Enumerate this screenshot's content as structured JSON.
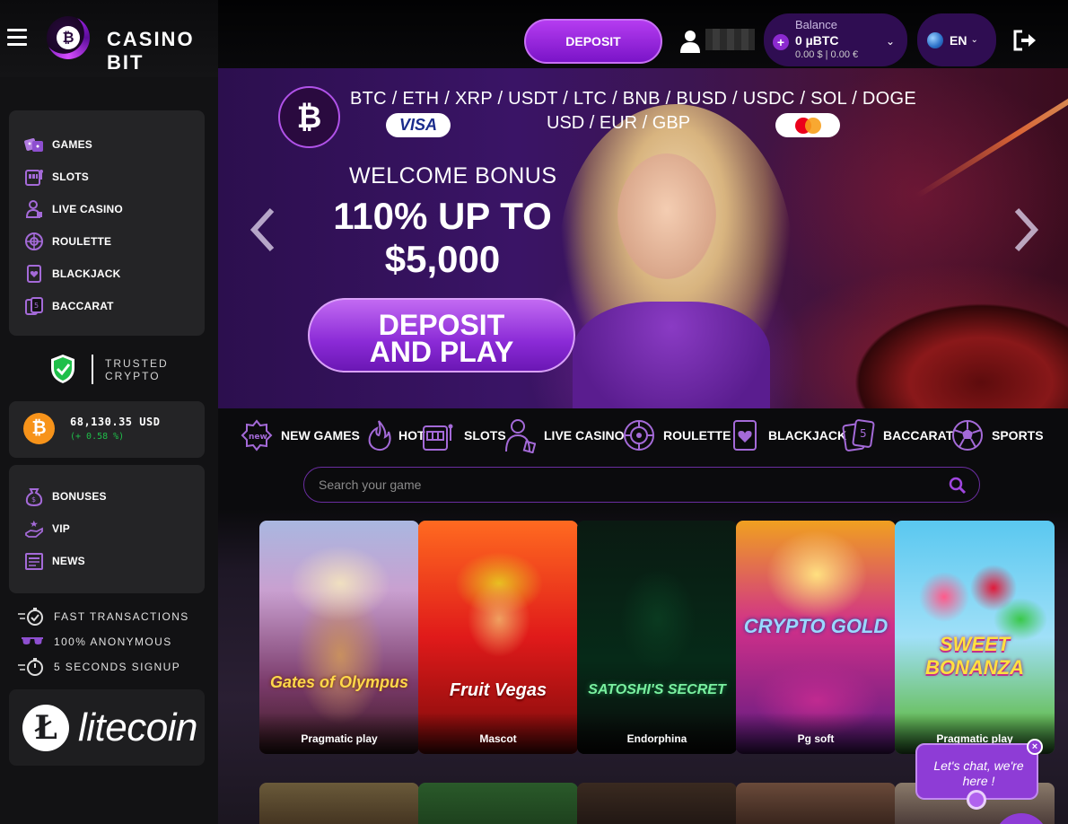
{
  "header": {
    "brand": "CASINO BIT",
    "deposit_label": "DEPOSIT",
    "balance_label": "Balance",
    "balance_value": "0 µBTC",
    "balance_sub": "0.00 $  |   0.00 €",
    "language": "EN"
  },
  "sidebar": {
    "nav": [
      {
        "label": "GAMES",
        "icon": "dice-icon"
      },
      {
        "label": "SLOTS",
        "icon": "slot-machine-icon"
      },
      {
        "label": "LIVE CASINO",
        "icon": "dealer-icon"
      },
      {
        "label": "ROULETTE",
        "icon": "roulette-icon"
      },
      {
        "label": "BLACKJACK",
        "icon": "card-heart-icon"
      },
      {
        "label": "BACCARAT",
        "icon": "cards-icon"
      }
    ],
    "trusted_line1": "TRUSTED",
    "trusted_line2": "CRYPTO",
    "btc_price": "68,130.35 USD",
    "btc_change": "(+ 0.58 %)",
    "info_nav": [
      {
        "label": "BONUSES",
        "icon": "money-bag-icon"
      },
      {
        "label": "VIP",
        "icon": "vip-hand-icon"
      },
      {
        "label": "NEWS",
        "icon": "newspaper-icon"
      }
    ],
    "features": [
      {
        "label": "FAST TRANSACTIONS",
        "icon": "stopwatch-check-icon"
      },
      {
        "label": "100% ANONYMOUS",
        "icon": "sunglasses-icon"
      },
      {
        "label": "5 SECONDS SIGNUP",
        "icon": "stopwatch-icon"
      }
    ],
    "litecoin_text": "litecoin"
  },
  "hero": {
    "cryptos": "BTC / ETH / XRP / USDT / LTC / BNB / BUSD / USDC / SOL / DOGE",
    "fiat": "USD / EUR / GBP",
    "visa": "VISA",
    "welcome": "WELCOME BONUS",
    "amount_line1": "110% UP TO",
    "amount_line2": "$5,000",
    "cta_line1": "DEPOSIT",
    "cta_line2": "AND PLAY"
  },
  "categories": [
    {
      "label": "NEW GAMES",
      "icon": "new-badge-icon"
    },
    {
      "label": "HOT",
      "icon": "flame-icon"
    },
    {
      "label": "SLOTS",
      "icon": "slot-machine-icon"
    },
    {
      "label": "LIVE CASINO",
      "icon": "dealer-icon"
    },
    {
      "label": "ROULETTE",
      "icon": "roulette-icon"
    },
    {
      "label": "BLACKJACK",
      "icon": "card-heart-icon"
    },
    {
      "label": "BACCARAT",
      "icon": "cards-icon"
    },
    {
      "label": "SPORTS",
      "icon": "soccer-ball-icon"
    }
  ],
  "search": {
    "placeholder": "Search your game"
  },
  "games": [
    {
      "title": "Gates of Olympus",
      "provider": "Pragmatic play"
    },
    {
      "title": "Fruit Vegas",
      "provider": "Mascot"
    },
    {
      "title": "SATOSHI'S SECRET",
      "provider": "Endorphina"
    },
    {
      "title": "CRYPTO GOLD",
      "provider": "Pg soft"
    },
    {
      "title": "SWEET BONANZA",
      "provider": "Pragmatic play"
    }
  ],
  "chat": {
    "text": "Let's chat, we're here !",
    "close": "×"
  },
  "colors": {
    "accent": "#8e3cd6",
    "accent_light": "#c870f5",
    "sidebar_panel": "#242426",
    "positive": "#1fbf4a",
    "bitcoin": "#f7931a"
  }
}
